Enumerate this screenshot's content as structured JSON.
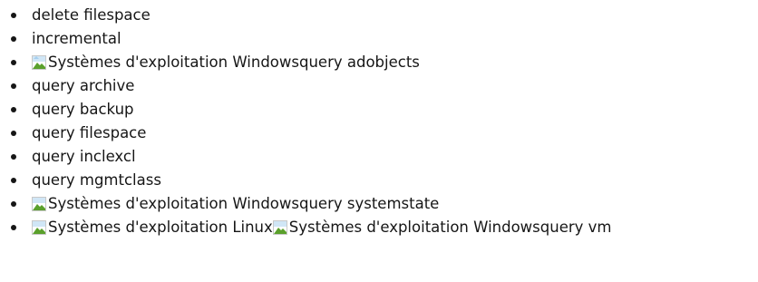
{
  "commands": [
    {
      "label": "delete filespace"
    },
    {
      "label": "incremental"
    },
    {
      "os_icons": [
        {
          "alt": "Systèmes d'exploitation Windows",
          "icon": "broken-image-icon"
        }
      ],
      "label": "query adobjects"
    },
    {
      "label": "query archive"
    },
    {
      "label": "query backup"
    },
    {
      "label": "query filespace"
    },
    {
      "label": "query inclexcl"
    },
    {
      "label": "query mgmtclass"
    },
    {
      "os_icons": [
        {
          "alt": "Systèmes d'exploitation Windows",
          "icon": "broken-image-icon"
        }
      ],
      "label": "query systemstate"
    },
    {
      "os_icons": [
        {
          "alt": "Systèmes d'exploitation Linux",
          "icon": "broken-image-icon"
        },
        {
          "alt": "Systèmes d'exploitation Windows",
          "icon": "broken-image-icon"
        }
      ],
      "label": "query vm"
    }
  ],
  "colors": {
    "text": "#161616",
    "bullet": "#161616"
  }
}
